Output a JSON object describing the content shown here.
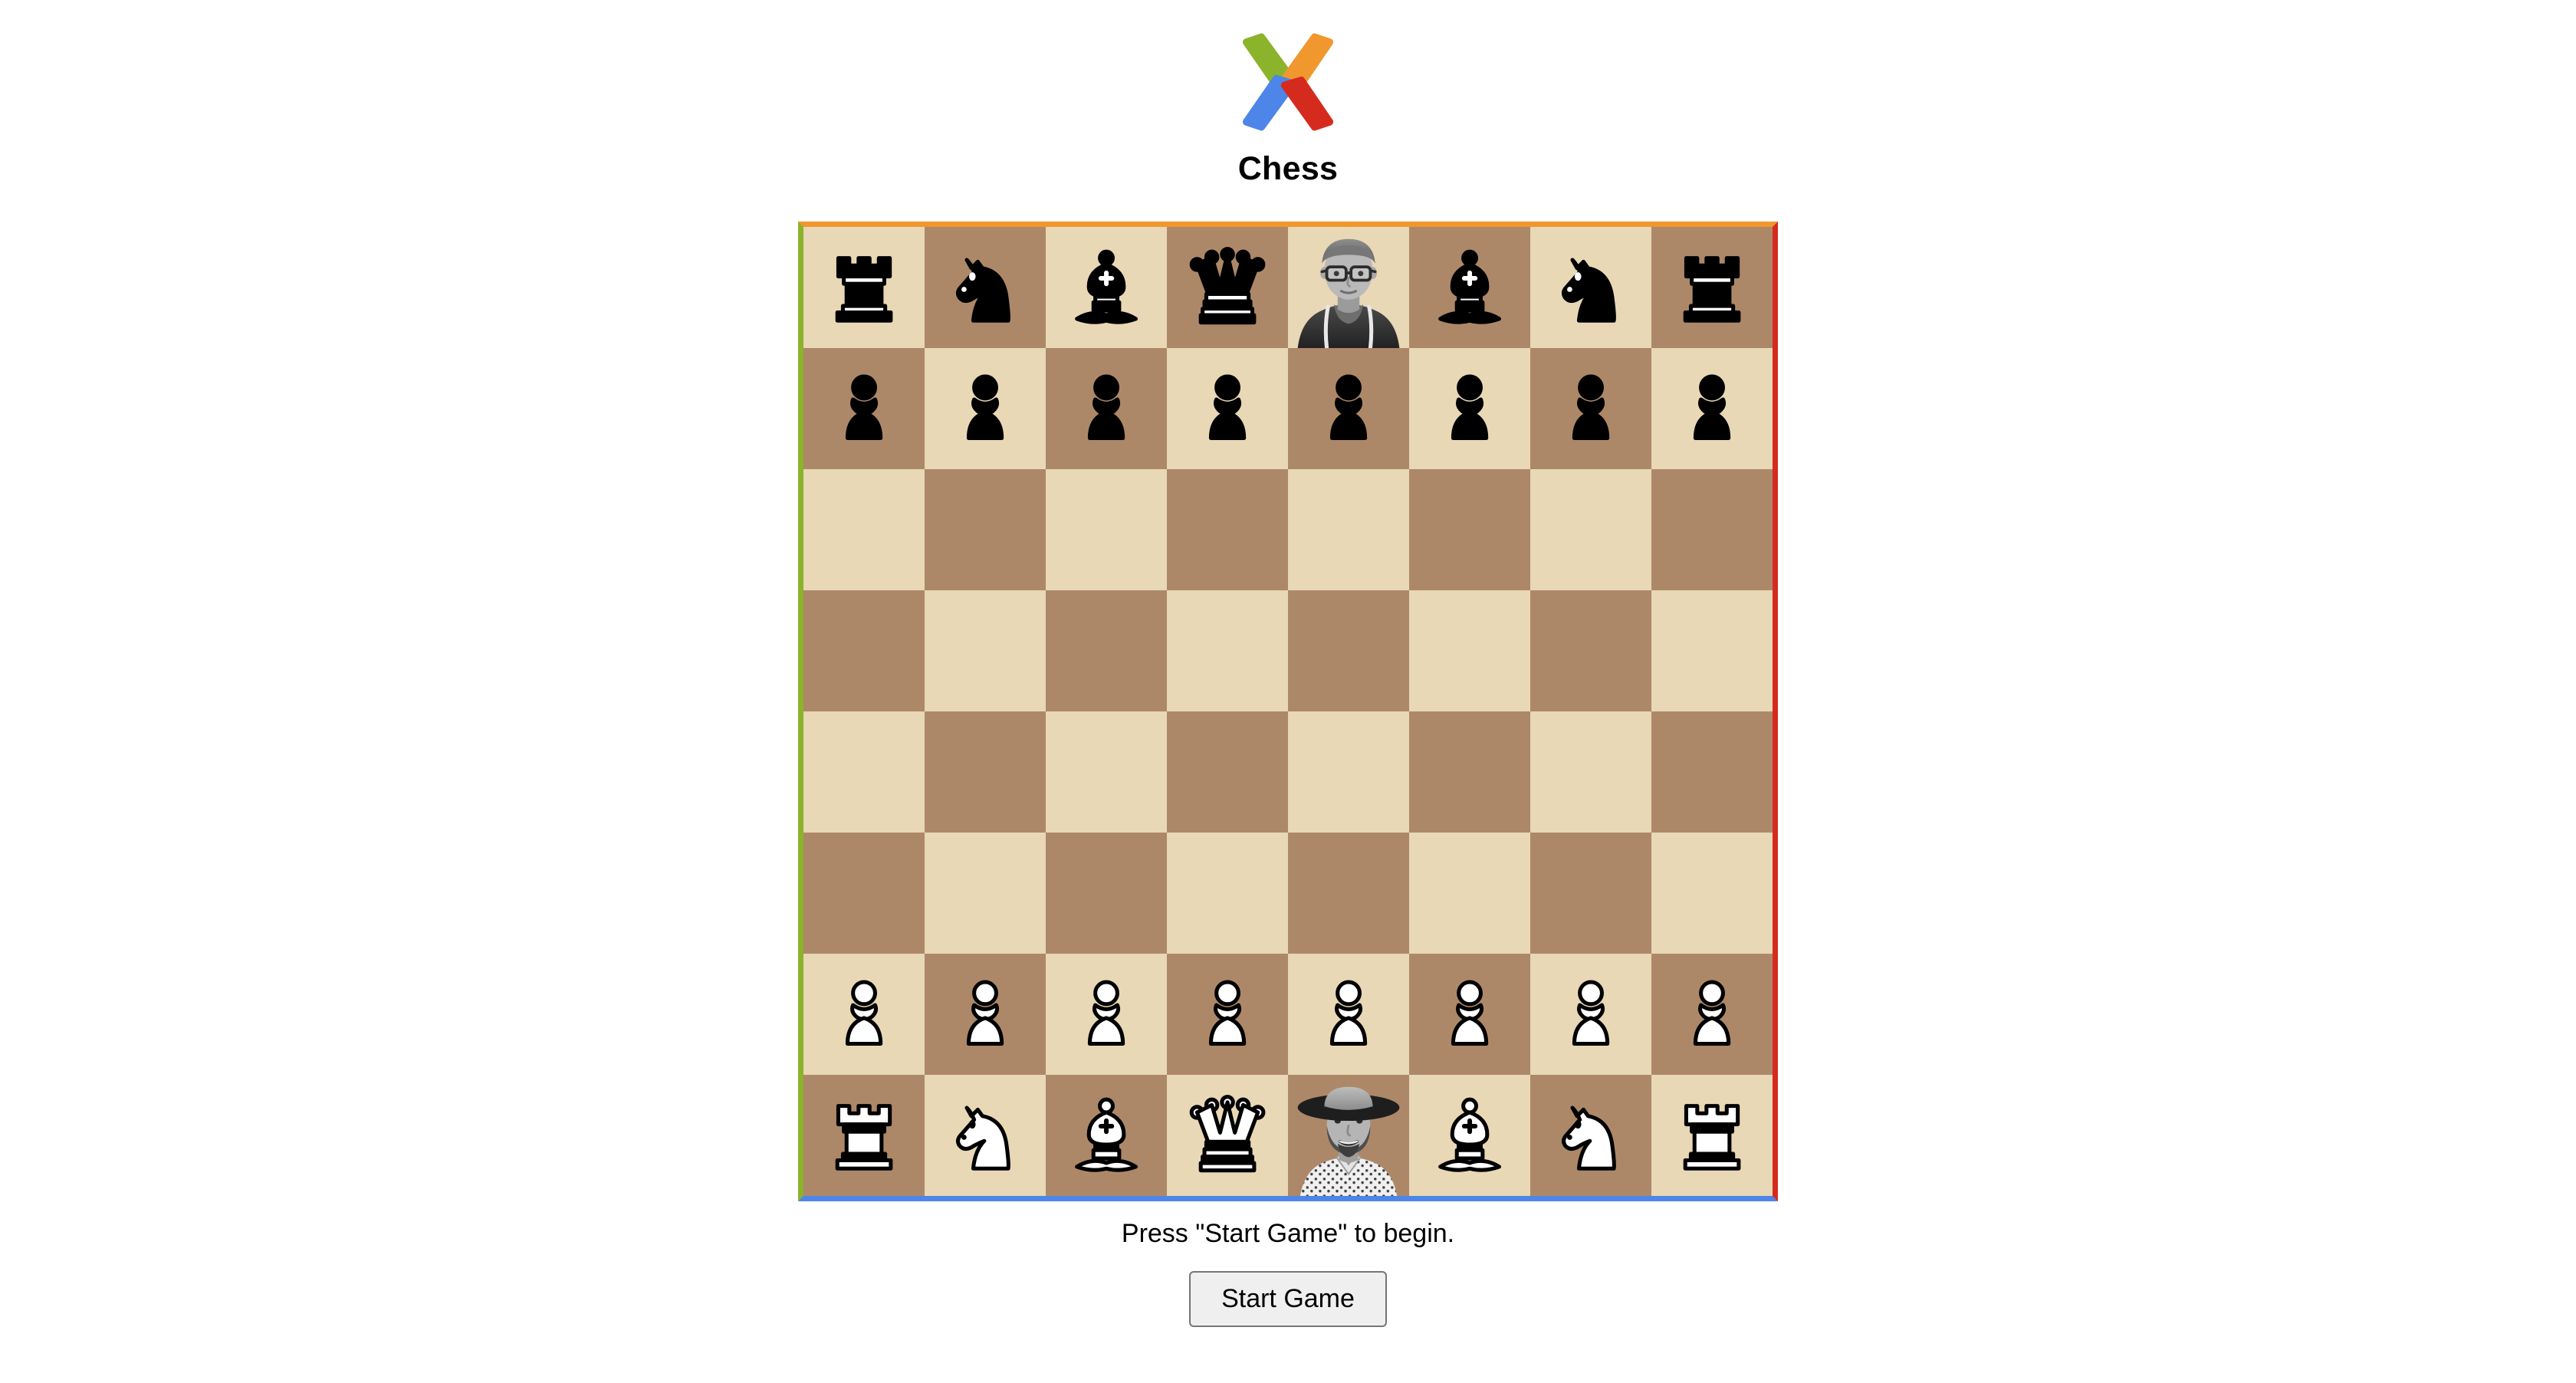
{
  "app": {
    "title": "Chess",
    "logo_icon": "x-logo-icon",
    "logo_colors": {
      "top_left": "#8BB32B",
      "top_right": "#F0982D",
      "bottom_left": "#4E85E8",
      "bottom_right": "#D52B1E"
    }
  },
  "board": {
    "light_square_color": "#E8D8B5",
    "dark_square_color": "#AD8868",
    "border_top_color": "#F0982D",
    "border_right_color": "#D52B1E",
    "border_bottom_color": "#4E85E8",
    "border_left_color": "#8BB32B",
    "ranks": [
      {
        "rank": "8",
        "squares": [
          {
            "file": "a",
            "shade": "light",
            "piece": "black-rook",
            "color": "black"
          },
          {
            "file": "b",
            "shade": "dark",
            "piece": "black-knight",
            "color": "black"
          },
          {
            "file": "c",
            "shade": "light",
            "piece": "black-bishop",
            "color": "black"
          },
          {
            "file": "d",
            "shade": "dark",
            "piece": "black-queen",
            "color": "black"
          },
          {
            "file": "e",
            "shade": "light",
            "piece": "black-king-avatar",
            "color": "black"
          },
          {
            "file": "f",
            "shade": "dark",
            "piece": "black-bishop",
            "color": "black"
          },
          {
            "file": "g",
            "shade": "light",
            "piece": "black-knight",
            "color": "black"
          },
          {
            "file": "h",
            "shade": "dark",
            "piece": "black-rook",
            "color": "black"
          }
        ]
      },
      {
        "rank": "7",
        "squares": [
          {
            "file": "a",
            "shade": "dark",
            "piece": "black-pawn",
            "color": "black"
          },
          {
            "file": "b",
            "shade": "light",
            "piece": "black-pawn",
            "color": "black"
          },
          {
            "file": "c",
            "shade": "dark",
            "piece": "black-pawn",
            "color": "black"
          },
          {
            "file": "d",
            "shade": "light",
            "piece": "black-pawn",
            "color": "black"
          },
          {
            "file": "e",
            "shade": "dark",
            "piece": "black-pawn",
            "color": "black"
          },
          {
            "file": "f",
            "shade": "light",
            "piece": "black-pawn",
            "color": "black"
          },
          {
            "file": "g",
            "shade": "dark",
            "piece": "black-pawn",
            "color": "black"
          },
          {
            "file": "h",
            "shade": "light",
            "piece": "black-pawn",
            "color": "black"
          }
        ]
      },
      {
        "rank": "6",
        "squares": [
          {
            "file": "a",
            "shade": "light",
            "piece": null,
            "color": null
          },
          {
            "file": "b",
            "shade": "dark",
            "piece": null,
            "color": null
          },
          {
            "file": "c",
            "shade": "light",
            "piece": null,
            "color": null
          },
          {
            "file": "d",
            "shade": "dark",
            "piece": null,
            "color": null
          },
          {
            "file": "e",
            "shade": "light",
            "piece": null,
            "color": null
          },
          {
            "file": "f",
            "shade": "dark",
            "piece": null,
            "color": null
          },
          {
            "file": "g",
            "shade": "light",
            "piece": null,
            "color": null
          },
          {
            "file": "h",
            "shade": "dark",
            "piece": null,
            "color": null
          }
        ]
      },
      {
        "rank": "5",
        "squares": [
          {
            "file": "a",
            "shade": "dark",
            "piece": null,
            "color": null
          },
          {
            "file": "b",
            "shade": "light",
            "piece": null,
            "color": null
          },
          {
            "file": "c",
            "shade": "dark",
            "piece": null,
            "color": null
          },
          {
            "file": "d",
            "shade": "light",
            "piece": null,
            "color": null
          },
          {
            "file": "e",
            "shade": "dark",
            "piece": null,
            "color": null
          },
          {
            "file": "f",
            "shade": "light",
            "piece": null,
            "color": null
          },
          {
            "file": "g",
            "shade": "dark",
            "piece": null,
            "color": null
          },
          {
            "file": "h",
            "shade": "light",
            "piece": null,
            "color": null
          }
        ]
      },
      {
        "rank": "4",
        "squares": [
          {
            "file": "a",
            "shade": "light",
            "piece": null,
            "color": null
          },
          {
            "file": "b",
            "shade": "dark",
            "piece": null,
            "color": null
          },
          {
            "file": "c",
            "shade": "light",
            "piece": null,
            "color": null
          },
          {
            "file": "d",
            "shade": "dark",
            "piece": null,
            "color": null
          },
          {
            "file": "e",
            "shade": "light",
            "piece": null,
            "color": null
          },
          {
            "file": "f",
            "shade": "dark",
            "piece": null,
            "color": null
          },
          {
            "file": "g",
            "shade": "light",
            "piece": null,
            "color": null
          },
          {
            "file": "h",
            "shade": "dark",
            "piece": null,
            "color": null
          }
        ]
      },
      {
        "rank": "3",
        "squares": [
          {
            "file": "a",
            "shade": "dark",
            "piece": null,
            "color": null
          },
          {
            "file": "b",
            "shade": "light",
            "piece": null,
            "color": null
          },
          {
            "file": "c",
            "shade": "dark",
            "piece": null,
            "color": null
          },
          {
            "file": "d",
            "shade": "light",
            "piece": null,
            "color": null
          },
          {
            "file": "e",
            "shade": "dark",
            "piece": null,
            "color": null
          },
          {
            "file": "f",
            "shade": "light",
            "piece": null,
            "color": null
          },
          {
            "file": "g",
            "shade": "dark",
            "piece": null,
            "color": null
          },
          {
            "file": "h",
            "shade": "light",
            "piece": null,
            "color": null
          }
        ]
      },
      {
        "rank": "2",
        "squares": [
          {
            "file": "a",
            "shade": "light",
            "piece": "white-pawn",
            "color": "white"
          },
          {
            "file": "b",
            "shade": "dark",
            "piece": "white-pawn",
            "color": "white"
          },
          {
            "file": "c",
            "shade": "light",
            "piece": "white-pawn",
            "color": "white"
          },
          {
            "file": "d",
            "shade": "dark",
            "piece": "white-pawn",
            "color": "white"
          },
          {
            "file": "e",
            "shade": "light",
            "piece": "white-pawn",
            "color": "white"
          },
          {
            "file": "f",
            "shade": "dark",
            "piece": "white-pawn",
            "color": "white"
          },
          {
            "file": "g",
            "shade": "light",
            "piece": "white-pawn",
            "color": "white"
          },
          {
            "file": "h",
            "shade": "dark",
            "piece": "white-pawn",
            "color": "white"
          }
        ]
      },
      {
        "rank": "1",
        "squares": [
          {
            "file": "a",
            "shade": "dark",
            "piece": "white-rook",
            "color": "white"
          },
          {
            "file": "b",
            "shade": "light",
            "piece": "white-knight",
            "color": "white"
          },
          {
            "file": "c",
            "shade": "dark",
            "piece": "white-bishop",
            "color": "white"
          },
          {
            "file": "d",
            "shade": "light",
            "piece": "white-queen",
            "color": "white"
          },
          {
            "file": "e",
            "shade": "dark",
            "piece": "white-king-avatar",
            "color": "white"
          },
          {
            "file": "f",
            "shade": "light",
            "piece": "white-bishop",
            "color": "white"
          },
          {
            "file": "g",
            "shade": "dark",
            "piece": "white-knight",
            "color": "white"
          },
          {
            "file": "h",
            "shade": "light",
            "piece": "white-rook",
            "color": "white"
          }
        ]
      }
    ]
  },
  "status": {
    "message": "Press \"Start Game\" to begin."
  },
  "controls": {
    "start_button_label": "Start Game"
  }
}
